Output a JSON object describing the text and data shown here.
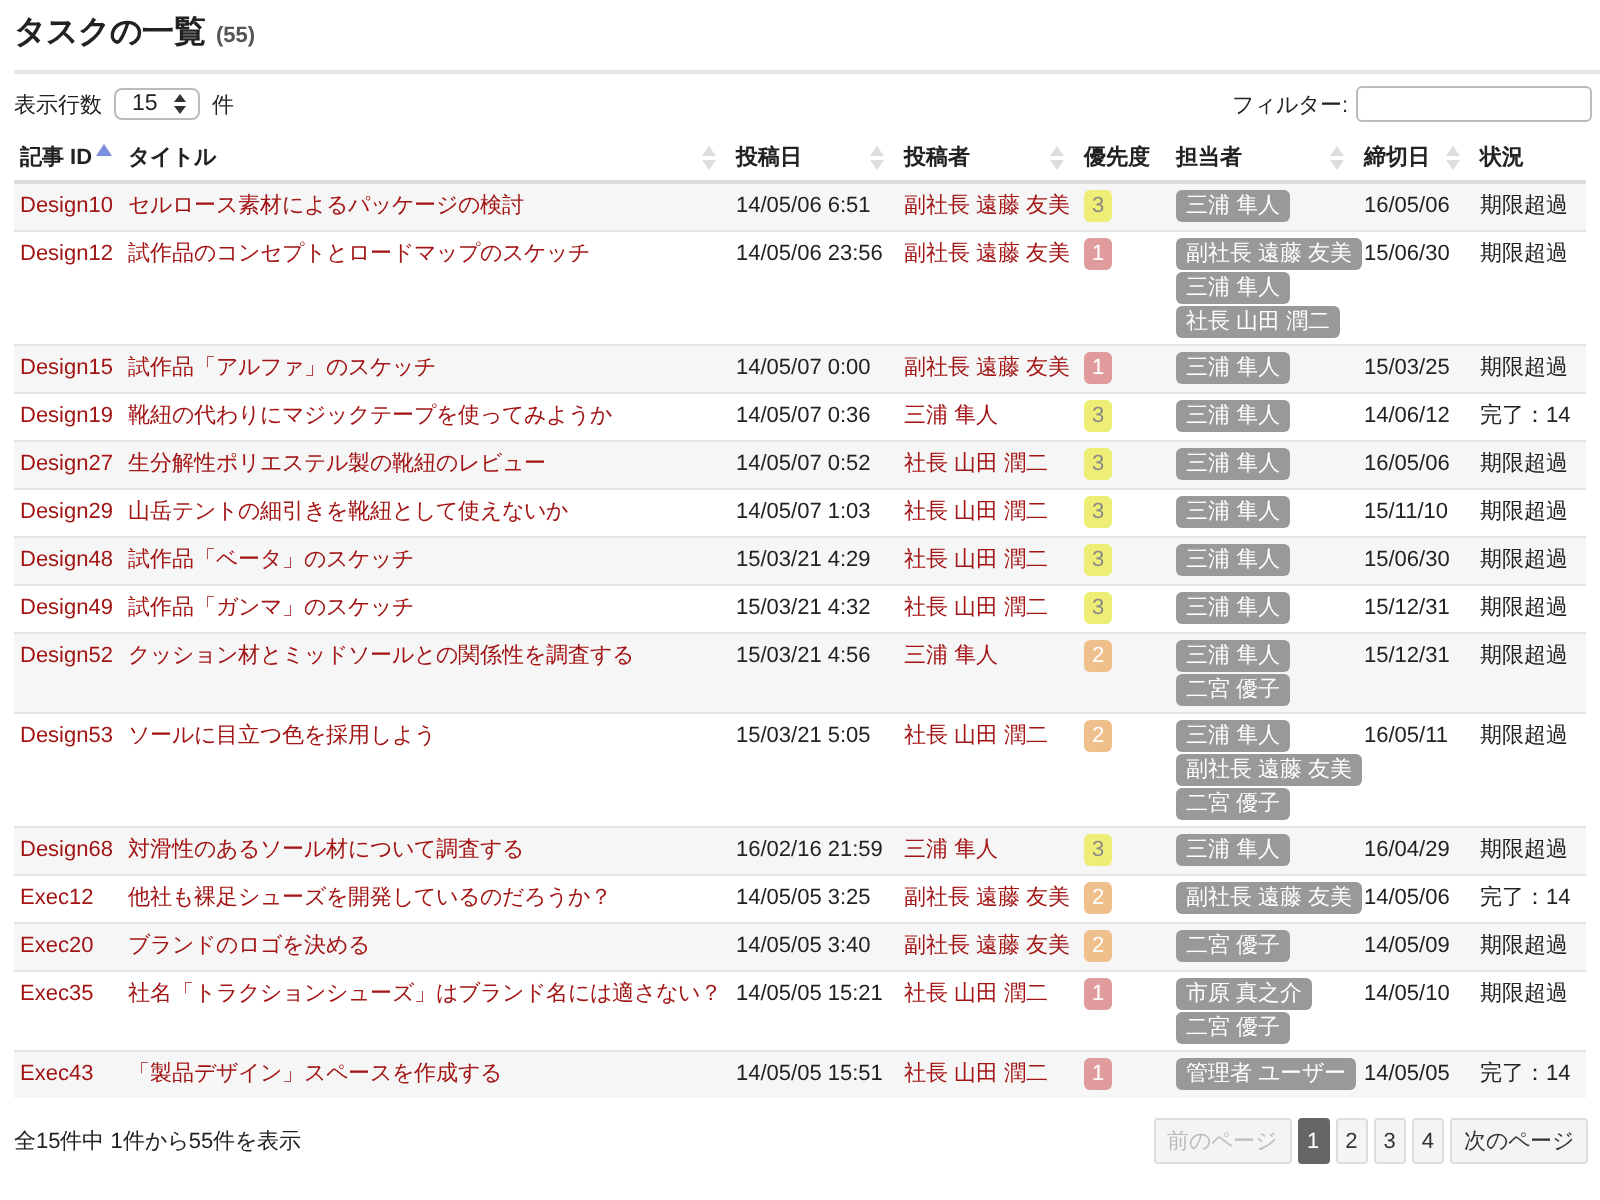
{
  "heading": {
    "title": "タスクの一覧",
    "count": "(55)"
  },
  "length_control": {
    "label": "表示行数",
    "value": "15",
    "unit": "件"
  },
  "filter": {
    "label": "フィルター:"
  },
  "table": {
    "columns": [
      {
        "label": "記事 ID",
        "sortable": true,
        "sorted": true
      },
      {
        "label": "タイトル",
        "sortable": true,
        "sorted": false
      },
      {
        "label": "投稿日",
        "sortable": true,
        "sorted": false
      },
      {
        "label": "投稿者",
        "sortable": true,
        "sorted": false
      },
      {
        "label": "優先度",
        "sortable": false,
        "sorted": false
      },
      {
        "label": "担当者",
        "sortable": true,
        "sorted": false
      },
      {
        "label": "締切日",
        "sortable": true,
        "sorted": false
      },
      {
        "label": "状況",
        "sortable": false,
        "sorted": false
      }
    ],
    "rows": [
      {
        "id": "Design10",
        "title": "セルロース素材によるパッケージの検討",
        "posted": "14/05/06 6:51",
        "poster": "副社長 遠藤 友美",
        "priority": {
          "label": "3",
          "color": "#eeee77"
        },
        "assignees": [
          "三浦 隼人"
        ],
        "deadline": "16/05/06",
        "status": "期限超過"
      },
      {
        "id": "Design12",
        "title": "試作品のコンセプトとロードマップのスケッチ",
        "posted": "14/05/06 23:56",
        "poster": "副社長 遠藤 友美",
        "priority": {
          "label": "1",
          "color": "#e09c9c"
        },
        "assignees": [
          "副社長 遠藤 友美",
          "三浦 隼人",
          "社長 山田 潤二"
        ],
        "deadline": "15/06/30",
        "status": "期限超過"
      },
      {
        "id": "Design15",
        "title": "試作品「アルファ」のスケッチ",
        "posted": "14/05/07 0:00",
        "poster": "副社長 遠藤 友美",
        "priority": {
          "label": "1",
          "color": "#e09c9c"
        },
        "assignees": [
          "三浦 隼人"
        ],
        "deadline": "15/03/25",
        "status": "期限超過"
      },
      {
        "id": "Design19",
        "title": "靴紐の代わりにマジックテープを使ってみようか",
        "posted": "14/05/07 0:36",
        "poster": "三浦 隼人",
        "priority": {
          "label": "3",
          "color": "#eeee77"
        },
        "assignees": [
          "三浦 隼人"
        ],
        "deadline": "14/06/12",
        "status": "完了：14"
      },
      {
        "id": "Design27",
        "title": "生分解性ポリエステル製の靴紐のレビュー",
        "posted": "14/05/07 0:52",
        "poster": "社長 山田 潤二",
        "priority": {
          "label": "3",
          "color": "#eeee77"
        },
        "assignees": [
          "三浦 隼人"
        ],
        "deadline": "16/05/06",
        "status": "期限超過"
      },
      {
        "id": "Design29",
        "title": "山岳テントの細引きを靴紐として使えないか",
        "posted": "14/05/07 1:03",
        "poster": "社長 山田 潤二",
        "priority": {
          "label": "3",
          "color": "#eeee77"
        },
        "assignees": [
          "三浦 隼人"
        ],
        "deadline": "15/11/10",
        "status": "期限超過"
      },
      {
        "id": "Design48",
        "title": "試作品「ベータ」のスケッチ",
        "posted": "15/03/21 4:29",
        "poster": "社長 山田 潤二",
        "priority": {
          "label": "3",
          "color": "#eeee77"
        },
        "assignees": [
          "三浦 隼人"
        ],
        "deadline": "15/06/30",
        "status": "期限超過"
      },
      {
        "id": "Design49",
        "title": "試作品「ガンマ」のスケッチ",
        "posted": "15/03/21 4:32",
        "poster": "社長 山田 潤二",
        "priority": {
          "label": "3",
          "color": "#eeee77"
        },
        "assignees": [
          "三浦 隼人"
        ],
        "deadline": "15/12/31",
        "status": "期限超過"
      },
      {
        "id": "Design52",
        "title": "クッション材とミッドソールとの関係性を調査する",
        "posted": "15/03/21 4:56",
        "poster": "三浦 隼人",
        "priority": {
          "label": "2",
          "color": "#f0c08c"
        },
        "assignees": [
          "三浦 隼人",
          "二宮 優子"
        ],
        "deadline": "15/12/31",
        "status": "期限超過"
      },
      {
        "id": "Design53",
        "title": "ソールに目立つ色を採用しよう",
        "posted": "15/03/21 5:05",
        "poster": "社長 山田 潤二",
        "priority": {
          "label": "2",
          "color": "#f0c08c"
        },
        "assignees": [
          "三浦 隼人",
          "副社長 遠藤 友美",
          "二宮 優子"
        ],
        "deadline": "16/05/11",
        "status": "期限超過"
      },
      {
        "id": "Design68",
        "title": "対滑性のあるソール材について調査する",
        "posted": "16/02/16 21:59",
        "poster": "三浦 隼人",
        "priority": {
          "label": "3",
          "color": "#eeee77"
        },
        "assignees": [
          "三浦 隼人"
        ],
        "deadline": "16/04/29",
        "status": "期限超過"
      },
      {
        "id": "Exec12",
        "title": "他社も裸足シューズを開発しているのだろうか？",
        "posted": "14/05/05 3:25",
        "poster": "副社長 遠藤 友美",
        "priority": {
          "label": "2",
          "color": "#f0c08c"
        },
        "assignees": [
          "副社長 遠藤 友美"
        ],
        "deadline": "14/05/06",
        "status": "完了：14"
      },
      {
        "id": "Exec20",
        "title": "ブランドのロゴを決める",
        "posted": "14/05/05 3:40",
        "poster": "副社長 遠藤 友美",
        "priority": {
          "label": "2",
          "color": "#f0c08c"
        },
        "assignees": [
          "二宮 優子"
        ],
        "deadline": "14/05/09",
        "status": "期限超過"
      },
      {
        "id": "Exec35",
        "title": "社名「トラクションシューズ」はブランド名には適さない？",
        "posted": "14/05/05 15:21",
        "poster": "社長 山田 潤二",
        "priority": {
          "label": "1",
          "color": "#e09c9c"
        },
        "assignees": [
          "市原 真之介",
          "二宮 優子"
        ],
        "deadline": "14/05/10",
        "status": "期限超過"
      },
      {
        "id": "Exec43",
        "title": "「製品デザイン」スペースを作成する",
        "posted": "14/05/05 15:51",
        "poster": "社長 山田 潤二",
        "priority": {
          "label": "1",
          "color": "#e09c9c"
        },
        "assignees": [
          "管理者 ユーザー"
        ],
        "deadline": "14/05/05",
        "status": "完了：14"
      }
    ]
  },
  "info": "全15件中 1件から55件を表示",
  "pagination": [
    {
      "label": "前のページ",
      "kind": "prev",
      "disabled": true,
      "selected": false
    },
    {
      "label": "1",
      "kind": "page",
      "disabled": false,
      "selected": true
    },
    {
      "label": "2",
      "kind": "page",
      "disabled": false,
      "selected": false
    },
    {
      "label": "3",
      "kind": "page",
      "disabled": false,
      "selected": false
    },
    {
      "label": "4",
      "kind": "page",
      "disabled": false,
      "selected": false
    },
    {
      "label": "次のページ",
      "kind": "next",
      "disabled": false,
      "selected": false
    }
  ]
}
